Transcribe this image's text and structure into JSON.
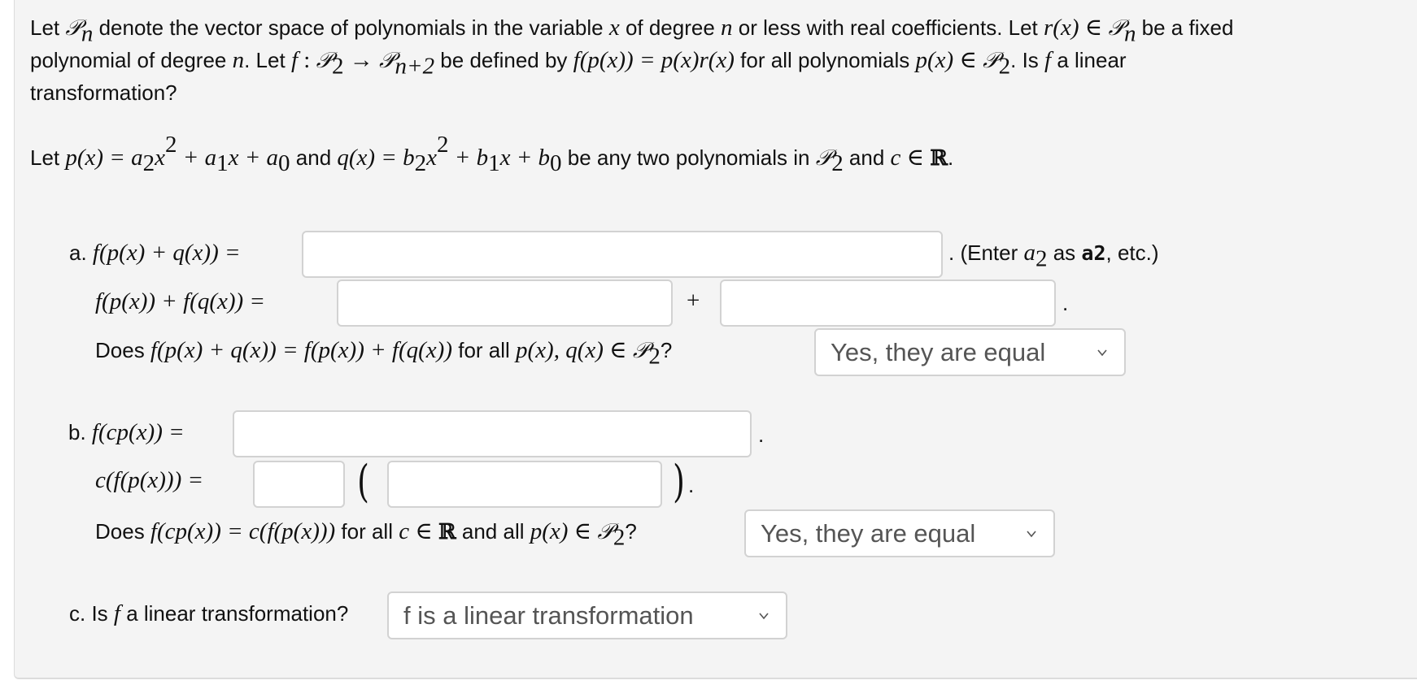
{
  "intro": {
    "line1": {
      "t1": "Let ",
      "P": "𝒫",
      "n": "n",
      "t2": " denote the vector space of polynomials in the variable ",
      "x": "x",
      "t3": " of degree ",
      "n2": "n",
      "t4": " or less with real coefficients. Let ",
      "rx": "r(x)",
      "in": " ∈ ",
      "P2": "𝒫",
      "n3": "n",
      "t5": " be a fixed"
    },
    "line2": {
      "t1": "polynomial of degree ",
      "n": "n",
      "t2": ". Let ",
      "f": "f",
      "colon": " : ",
      "P": "𝒫",
      "sub2": "2",
      "arrow": " → ",
      "P2": "𝒫",
      "subn2": "n+2",
      "t3": " be defined by ",
      "def": "f(p(x)) = p(x)r(x)",
      "t4": " for all polynomials ",
      "px": "p(x)",
      "in": " ∈ ",
      "P3": "𝒫",
      "sub3": "2",
      "t5": ". Is ",
      "f2": "f",
      "t6": " a linear"
    },
    "line3": "transformation?"
  },
  "setup": {
    "t1": "Let ",
    "px": "p(x) = a",
    "s2": "2",
    "x2": "x",
    "e2": "2",
    "plus1": " + a",
    "s1": "1",
    "x1": "x + a",
    "s0": "0",
    "t2": " and ",
    "qx": "q(x) = b",
    "bs2": "2",
    "bx2": "x",
    "be2": "2",
    "bplus1": " + b",
    "bs1": "1",
    "bx1": "x + b",
    "bs0": "0",
    "t3": " be any two polynomials in ",
    "P": "𝒫",
    "Ps": "2",
    "t4": " and ",
    "c": "c",
    "in": " ∈ ",
    "R": "ℝ",
    "end": "."
  },
  "part_a": {
    "label": "a. ",
    "lhs": "f(p(x) + q(x)) =",
    "input_sum_value": "",
    "hint": {
      "t1": ". (Enter ",
      "a": "a",
      "s": "2",
      "t2": " as ",
      "bold": "a2",
      "t3": ", etc.)"
    },
    "lhs2": "f(p(x)) + f(q(x)) =",
    "input_fp_value": "",
    "plus": "+",
    "input_fq_value": "",
    "period": ".",
    "question": {
      "t1": "Does ",
      "eq": "f(p(x) + q(x)) = f(p(x)) + f(q(x))",
      "t2": " for all ",
      "vars": "p(x), q(x)",
      "in": " ∈ ",
      "P": "𝒫",
      "s": "2",
      "q": "?"
    },
    "select_value": "Yes, they are equal"
  },
  "part_b": {
    "label": "b. ",
    "lhs": "f(cp(x)) =",
    "input_fcp_value": "",
    "period": ".",
    "lhs2": "c(f(p(x))) =",
    "input_scalar_value": "",
    "lparen": "(",
    "input_fp_value": "",
    "rparen": ")",
    "period2": ".",
    "question": {
      "t1": "Does ",
      "eq": "f(cp(x)) = c(f(p(x)))",
      "t2": " for all ",
      "c": "c",
      "in": " ∈ ",
      "R": "ℝ",
      "t3": " and all ",
      "px": "p(x)",
      "in2": " ∈ ",
      "P": "𝒫",
      "s": "2",
      "q": "?"
    },
    "select_value": "Yes, they are equal"
  },
  "part_c": {
    "label": "c. Is ",
    "f": "f",
    "t1": " a linear transformation?",
    "select_value": "f is a linear transformation"
  },
  "colors": {
    "panel_bg": "#f4f4f4",
    "field_border": "#d2d2d2",
    "select_text": "#555555"
  }
}
